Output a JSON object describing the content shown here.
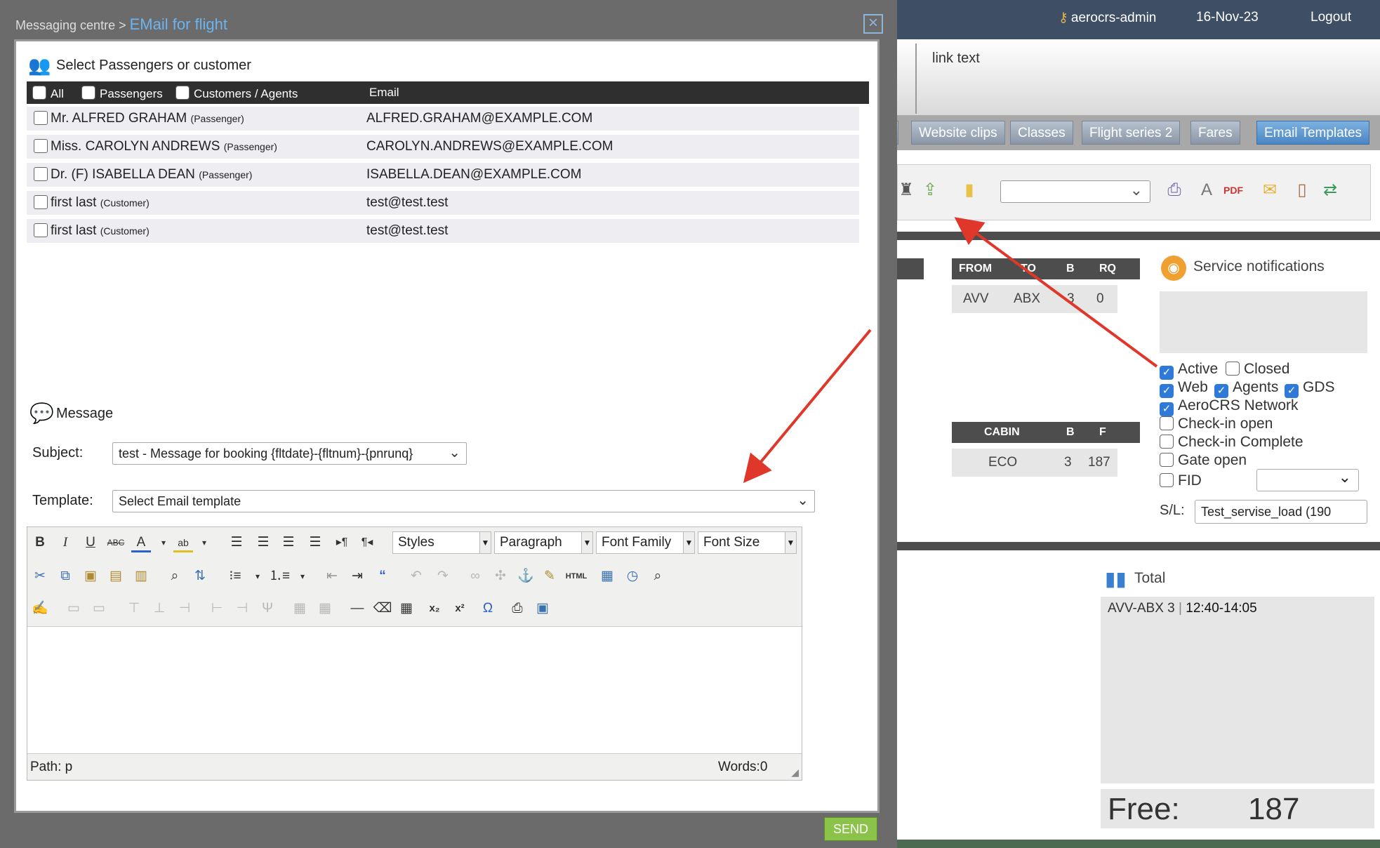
{
  "modal": {
    "breadcrumb": "Messaging centre >",
    "title": "EMail for flight",
    "close_icon": "close-icon",
    "select_title": "Select Passengers or customer",
    "headers": {
      "all": "All",
      "passengers": "Passengers",
      "customers": "Customers / Agents",
      "email": "Email"
    },
    "rows": [
      {
        "name": "Mr. ALFRED GRAHAM",
        "type": "(Passenger)",
        "email": "ALFRED.GRAHAM@EXAMPLE.COM"
      },
      {
        "name": "Miss. CAROLYN ANDREWS",
        "type": "(Passenger)",
        "email": "CAROLYN.ANDREWS@EXAMPLE.COM"
      },
      {
        "name": "Dr. (F) ISABELLA DEAN",
        "type": "(Passenger)",
        "email": "ISABELLA.DEAN@EXAMPLE.COM"
      },
      {
        "name": "first last",
        "type": "(Customer)",
        "email": "test@test.test"
      },
      {
        "name": "first last",
        "type": "(Customer)",
        "email": "test@test.test"
      }
    ],
    "message_title": "Message",
    "subject_label": "Subject:",
    "subject_value": "test - Message for booking {fltdate}-{fltnum}-{pnrunq}",
    "template_label": "Template:",
    "template_value": "Select Email template",
    "editor": {
      "styles": "Styles",
      "paragraph": "Paragraph",
      "font_family": "Font Family",
      "font_size": "Font Size",
      "path": "Path: p",
      "words": "Words:0"
    },
    "send_label": "SEND"
  },
  "app": {
    "user": "aerocrs-admin",
    "date": "16-Nov-23",
    "logout": "Logout",
    "link_text": "link text",
    "tabs": [
      "Website clips",
      "Classes",
      "Flight series 2",
      "Fares",
      "Email Templates"
    ],
    "route_table": {
      "headers": [
        "FROM",
        "TO",
        "B",
        "RQ"
      ],
      "row": [
        "AVV",
        "ABX",
        "3",
        "0"
      ]
    },
    "cabin_table": {
      "headers": [
        "CABIN",
        "B",
        "F"
      ],
      "row": [
        "ECO",
        "3",
        "187"
      ]
    },
    "service_notifications": "Service notifications",
    "filters": [
      {
        "label": "Active",
        "checked": true
      },
      {
        "label": "Closed",
        "checked": false
      },
      {
        "label": "Web",
        "checked": true
      },
      {
        "label": "Agents",
        "checked": true
      },
      {
        "label": "GDS",
        "checked": true
      },
      {
        "label": "AeroCRS Network",
        "checked": true
      },
      {
        "label": "Check-in open",
        "checked": false
      },
      {
        "label": "Check-in Complete",
        "checked": false
      },
      {
        "label": "Gate open",
        "checked": false
      },
      {
        "label": "FID",
        "checked": false
      }
    ],
    "sl_label": "S/L:",
    "sl_value": "Test_servise_load (190",
    "total_title": "Total",
    "total_route": "AVV-ABX 3",
    "total_time": "12:40-14:05",
    "free_label": "Free:",
    "free_value": "187"
  },
  "colors": {
    "accent_red": "#e0372b",
    "send_green": "#8bc34a",
    "header_dark": "#2f2f2f",
    "topbar": "#3e4f65"
  }
}
